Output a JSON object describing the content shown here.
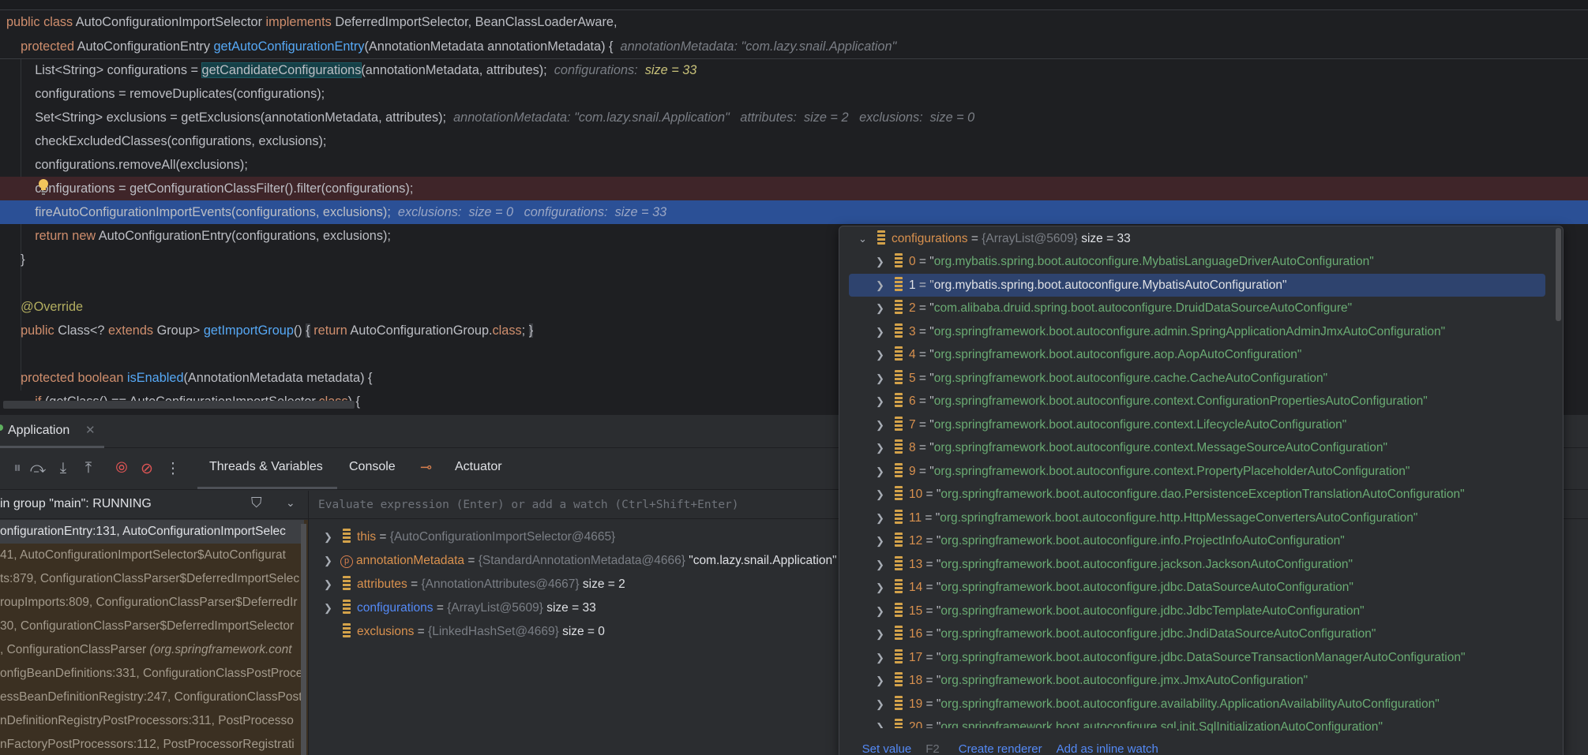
{
  "colors": {
    "keyword": "#cf8e6d",
    "method": "#56a8f5",
    "string": "#6aab73",
    "breakpoint_line": "#3f2529",
    "current_line": "#2b5096",
    "link": "#548af7"
  },
  "editor": {
    "lines": [
      [
        {
          "c": "kw",
          "t": "public "
        },
        {
          "c": "kw",
          "t": "class "
        },
        {
          "c": "id",
          "t": "AutoConfigurationImportSelector "
        },
        {
          "c": "kw",
          "t": "implements "
        },
        {
          "c": "id",
          "t": "DeferredImportSelector, BeanClassLoaderAware,"
        }
      ],
      [
        {
          "c": "id",
          "t": "    "
        },
        {
          "c": "kw",
          "t": "protected "
        },
        {
          "c": "id",
          "t": "AutoConfigurationEntry "
        },
        {
          "c": "fn",
          "t": "getAutoConfigurationEntry"
        },
        {
          "c": "id",
          "t": "(AnnotationMetadata annotationMetadata) {  "
        },
        {
          "c": "hint",
          "t": "annotationMetadata: \"com.lazy.snail.Application\""
        }
      ],
      [
        {
          "c": "id",
          "t": "        List<String> configurations = "
        },
        {
          "c": "sel",
          "t": "getCandidateConfigurations"
        },
        {
          "c": "id",
          "t": "(annotationMetadata, attributes);  "
        },
        {
          "c": "hint",
          "t": "configurations:  "
        },
        {
          "c": "hintY",
          "t": "size = 33"
        }
      ],
      [
        {
          "c": "id",
          "t": "        configurations = removeDuplicates(configurations);"
        }
      ],
      [
        {
          "c": "id",
          "t": "        Set<String> exclusions = getExclusions(annotationMetadata, attributes);  "
        },
        {
          "c": "hint",
          "t": "annotationMetadata: \"com.lazy.snail.Application\"   attributes:  size = 2   exclusions:  size = 0"
        }
      ],
      [
        {
          "c": "id",
          "t": "        checkExcludedClasses(configurations, exclusions);"
        }
      ],
      [
        {
          "c": "id",
          "t": "        configurations.removeAll(exclusions);"
        }
      ],
      [
        {
          "c": "id",
          "t": "        configurations = getConfigurationClassFilter().filter(configurations);"
        }
      ],
      [
        {
          "c": "id",
          "t": "        fireAutoConfigurationImportEvents(configurations, exclusions);  "
        },
        {
          "c": "hint",
          "t": "exclusions:  size = 0   configurations:  size = 33"
        }
      ],
      [
        {
          "c": "id",
          "t": "        "
        },
        {
          "c": "kw",
          "t": "return new "
        },
        {
          "c": "id",
          "t": "AutoConfigurationEntry(configurations, exclusions);"
        }
      ],
      [
        {
          "c": "id",
          "t": "    }"
        }
      ],
      [],
      [
        {
          "c": "ann",
          "t": "    @Override"
        }
      ],
      [
        {
          "c": "id",
          "t": "    "
        },
        {
          "c": "kw",
          "t": "public "
        },
        {
          "c": "id",
          "t": "Class<? "
        },
        {
          "c": "kw",
          "t": "extends "
        },
        {
          "c": "id",
          "t": "Group> "
        },
        {
          "c": "fn",
          "t": "getImportGroup"
        },
        {
          "c": "id",
          "t": "() "
        },
        {
          "c": "fold",
          "t": "{"
        },
        {
          "c": "kw",
          "t": " return "
        },
        {
          "c": "id",
          "t": "AutoConfigurationGroup."
        },
        {
          "c": "kw",
          "t": "class"
        },
        {
          "c": "id",
          "t": "; "
        },
        {
          "c": "fold",
          "t": "}"
        }
      ],
      [],
      [
        {
          "c": "id",
          "t": "    "
        },
        {
          "c": "kw",
          "t": "protected boolean "
        },
        {
          "c": "fn",
          "t": "isEnabled"
        },
        {
          "c": "id",
          "t": "(AnnotationMetadata metadata) {"
        }
      ],
      [
        {
          "c": "id",
          "t": "        "
        },
        {
          "c": "kw",
          "t": "if "
        },
        {
          "c": "id",
          "t": "(getClass() == AutoConfigurationImportSelector."
        },
        {
          "c": "kw",
          "t": "class"
        },
        {
          "c": "id",
          "t": ") {"
        }
      ]
    ],
    "breakpoint_line_index": 7,
    "current_line_index": 8
  },
  "debug": {
    "tab_label": "Application",
    "close_glyph": "✕",
    "toolbar_icons": [
      "pause-icon",
      "step-over-icon",
      "step-into-icon",
      "step-out-icon",
      "view-breakpoints-icon",
      "mute-breakpoints-icon",
      "more-icon"
    ],
    "tabs": {
      "threads": "Threads & Variables",
      "console": "Console",
      "actuator": "Actuator"
    },
    "thread_status": "in group \"main\": RUNNING",
    "eval_placeholder": "Evaluate expression (Enter) or add a watch (Ctrl+Shift+Enter)",
    "frames": [
      {
        "text": "onfigurationEntry:131, AutoConfigurationImportSelec"
      },
      {
        "text": "41, AutoConfigurationImportSelector$AutoConfigurat"
      },
      {
        "text": "ts:879, ConfigurationClassParser$DeferredImportSelec"
      },
      {
        "text": "roupImports:809, ConfigurationClassParser$DeferredIr"
      },
      {
        "text": "30, ConfigurationClassParser$DeferredImportSelector"
      },
      {
        "text": ", ConfigurationClassParser ",
        "italic": "(org.springframework.cont"
      },
      {
        "text": "onfigBeanDefinitions:331, ConfigurationClassPostProce"
      },
      {
        "text": "essBeanDefinitionRegistry:247, ConfigurationClassPost"
      },
      {
        "text": "nDefinitionRegistryPostProcessors:311, PostProcesso"
      },
      {
        "text": "nFactoryPostProcessors:112, PostProcessorRegistrati"
      }
    ],
    "variables": [
      {
        "name": "this",
        "value": "{AutoConfigurationImportSelector@4665}",
        "extra": "",
        "icon": "field",
        "expandable": true
      },
      {
        "name": "annotationMetadata",
        "value": "{StandardAnnotationMetadata@4666}",
        "extra": "\"com.lazy.snail.Application\"",
        "icon": "parameter",
        "expandable": true
      },
      {
        "name": "attributes",
        "value": "{AnnotationAttributes@4667}",
        "extra": "size = 2",
        "icon": "field",
        "expandable": true
      },
      {
        "name": "configurations",
        "value": "{ArrayList@5609}",
        "extra": "size = 33",
        "icon": "field",
        "expandable": true,
        "changed": true
      },
      {
        "name": "exclusions",
        "value": "{LinkedHashSet@4669}",
        "extra": "size = 0",
        "icon": "field",
        "expandable": false
      }
    ]
  },
  "popup": {
    "root": {
      "name": "configurations",
      "value": "{ArrayList@5609}",
      "extra": "size = 33"
    },
    "items": [
      "org.mybatis.spring.boot.autoconfigure.MybatisLanguageDriverAutoConfiguration",
      "org.mybatis.spring.boot.autoconfigure.MybatisAutoConfiguration",
      "com.alibaba.druid.spring.boot.autoconfigure.DruidDataSourceAutoConfigure",
      "org.springframework.boot.autoconfigure.admin.SpringApplicationAdminJmxAutoConfiguration",
      "org.springframework.boot.autoconfigure.aop.AopAutoConfiguration",
      "org.springframework.boot.autoconfigure.cache.CacheAutoConfiguration",
      "org.springframework.boot.autoconfigure.context.ConfigurationPropertiesAutoConfiguration",
      "org.springframework.boot.autoconfigure.context.LifecycleAutoConfiguration",
      "org.springframework.boot.autoconfigure.context.MessageSourceAutoConfiguration",
      "org.springframework.boot.autoconfigure.context.PropertyPlaceholderAutoConfiguration",
      "org.springframework.boot.autoconfigure.dao.PersistenceExceptionTranslationAutoConfiguration",
      "org.springframework.boot.autoconfigure.http.HttpMessageConvertersAutoConfiguration",
      "org.springframework.boot.autoconfigure.info.ProjectInfoAutoConfiguration",
      "org.springframework.boot.autoconfigure.jackson.JacksonAutoConfiguration",
      "org.springframework.boot.autoconfigure.jdbc.DataSourceAutoConfiguration",
      "org.springframework.boot.autoconfigure.jdbc.JdbcTemplateAutoConfiguration",
      "org.springframework.boot.autoconfigure.jdbc.JndiDataSourceAutoConfiguration",
      "org.springframework.boot.autoconfigure.jdbc.DataSourceTransactionManagerAutoConfiguration",
      "org.springframework.boot.autoconfigure.jmx.JmxAutoConfiguration",
      "org.springframework.boot.autoconfigure.availability.ApplicationAvailabilityAutoConfiguration",
      "org.springframework.boot.autoconfigure.sql.init.SqlInitializationAutoConfiguration"
    ],
    "selected_index": 1,
    "footer": {
      "set_value": "Set value",
      "set_value_key": "F2",
      "create_renderer": "Create renderer",
      "add_inline_watch": "Add as inline watch"
    }
  }
}
